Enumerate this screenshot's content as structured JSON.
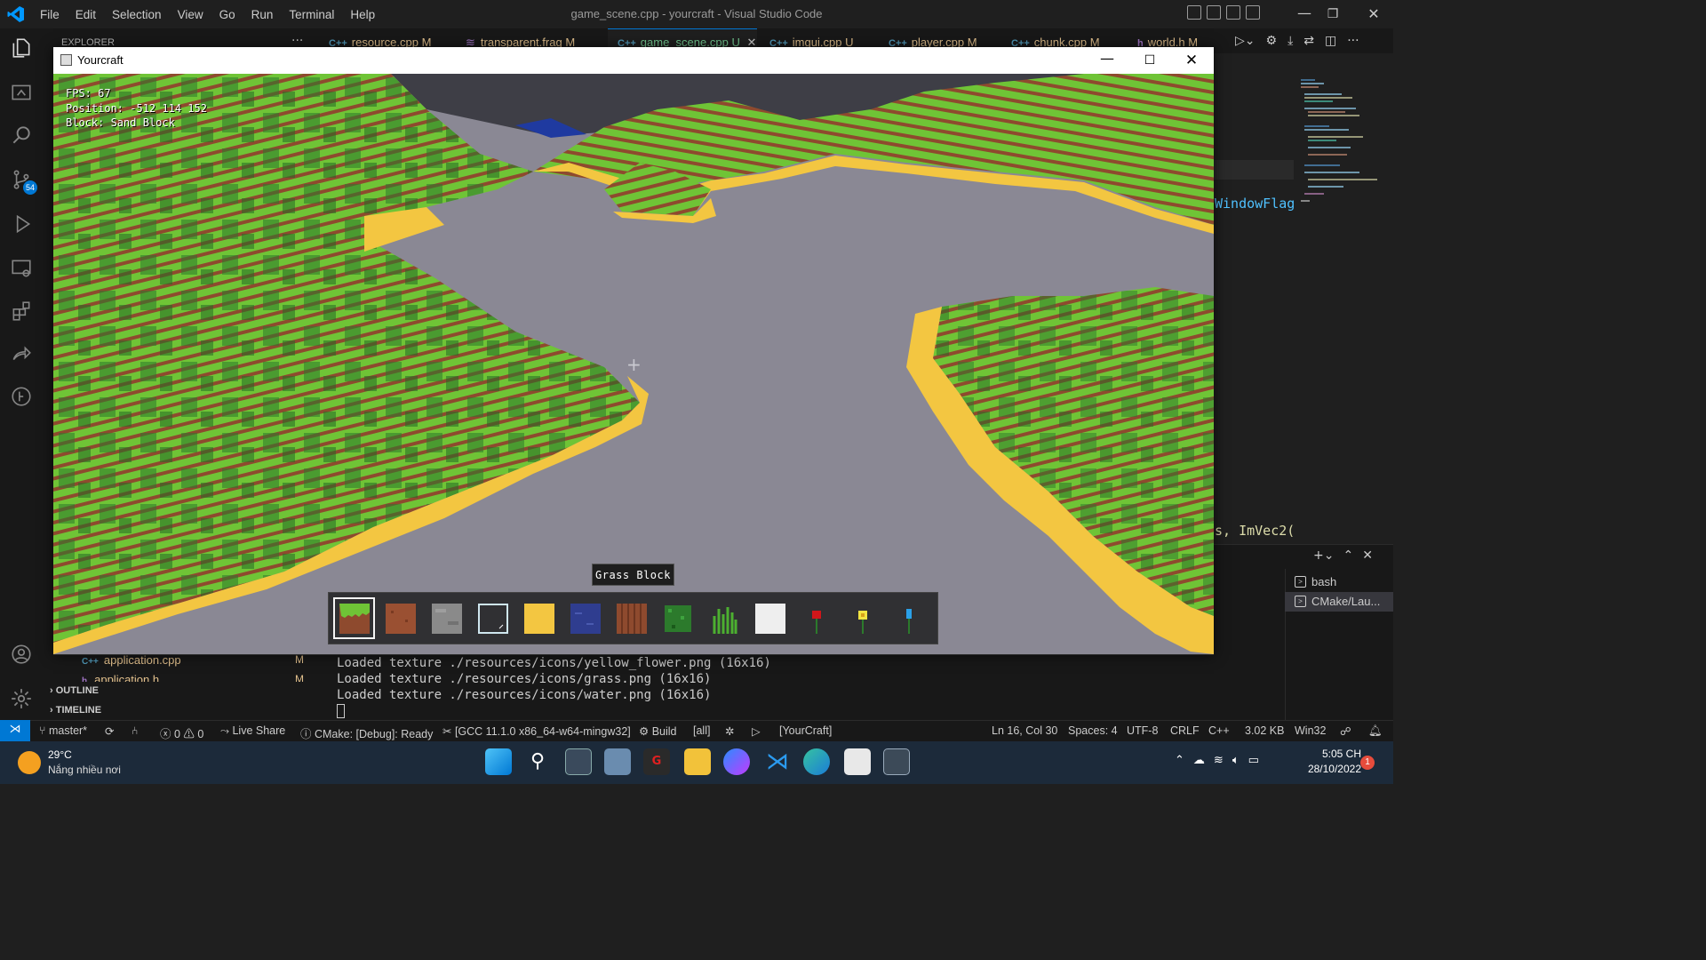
{
  "vscode": {
    "menu": [
      "File",
      "Edit",
      "Selection",
      "View",
      "Go",
      "Run",
      "Terminal",
      "Help"
    ],
    "window_title": "game_scene.cpp - yourcraft - Visual Studio Code",
    "activity_badge": "54",
    "explorer_label": "EXPLORER",
    "explorer_files": [
      {
        "name": "application.cpp",
        "status": "M"
      },
      {
        "name": "application.h",
        "status": "M"
      }
    ],
    "sections": [
      "OUTLINE",
      "TIMELINE"
    ],
    "tabs": [
      {
        "name": "resource.cpp",
        "status": "M",
        "type": "cpp"
      },
      {
        "name": "transparent.frag",
        "status": "M",
        "type": "frag"
      },
      {
        "name": "game_scene.cpp",
        "status": "U",
        "type": "cpp",
        "active": true
      },
      {
        "name": "imgui.cpp",
        "status": "U",
        "type": "cpp"
      },
      {
        "name": "player.cpp",
        "status": "M",
        "type": "cpp"
      },
      {
        "name": "chunk.cpp",
        "status": "M",
        "type": "cpp"
      },
      {
        "name": "world.h",
        "status": "M",
        "type": "h"
      }
    ],
    "code_fragments": [
      "WindowFlag",
      "s, ImVec2("
    ],
    "terminal_lines": [
      "Loaded texture ./resources/icons/yellow_flower.png (16x16)",
      "Loaded texture ./resources/icons/grass.png (16x16)",
      "Loaded texture ./resources/icons/water.png (16x16)"
    ],
    "terminals": [
      "bash",
      "CMake/Lau..."
    ],
    "status_left": {
      "branch": "master*",
      "problems_errors": "0",
      "problems_warnings": "0",
      "live_share": "Live Share",
      "cmake": "CMake: [Debug]: Ready",
      "kit": "[GCC 11.1.0 x86_64-w64-mingw32]",
      "build": "Build",
      "target": "[all]",
      "launch_target": "[YourCraft]"
    },
    "status_right": {
      "position": "Ln 16, Col 30",
      "spaces": "Spaces: 4",
      "encoding": "UTF-8",
      "eol": "CRLF",
      "language": "C++",
      "size": "3.02 KB",
      "platform": "Win32"
    }
  },
  "game": {
    "window_title": "Yourcraft",
    "hud": {
      "fps": "FPS: 67",
      "position": "Position: -512 114 152",
      "block": "Block: Sand Block"
    },
    "tooltip": "Grass Block",
    "hotbar": [
      {
        "name": "grass-block",
        "selected": true
      },
      {
        "name": "dirt-block"
      },
      {
        "name": "stone-block"
      },
      {
        "name": "glass-block"
      },
      {
        "name": "sand-block"
      },
      {
        "name": "water-block"
      },
      {
        "name": "wood-block"
      },
      {
        "name": "leaves-block"
      },
      {
        "name": "grass-plant"
      },
      {
        "name": "snow-block"
      },
      {
        "name": "red-flower"
      },
      {
        "name": "yellow-flower"
      },
      {
        "name": "blue-flower"
      }
    ],
    "colors": {
      "sky": "#8a8894",
      "grass": "#6fc436",
      "dirt": "#8e4a2e",
      "sand": "#f3c641",
      "tree": "#2c7a2c",
      "water": "#2f3d8f"
    }
  },
  "taskbar": {
    "weather_temp": "29°C",
    "weather_desc": "Nắng nhiều nơi",
    "time": "5:05 CH",
    "date": "28/10/2022",
    "notifications": "1"
  }
}
